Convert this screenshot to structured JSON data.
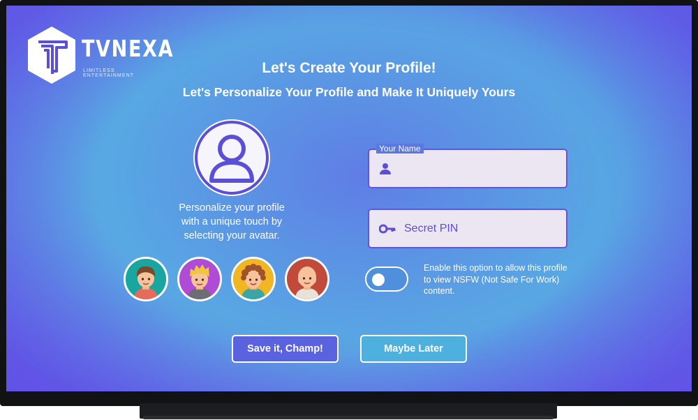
{
  "brand": {
    "name": "TVNEXA",
    "tagline": "LIMITLESS ENTERTAINMENT"
  },
  "header": {
    "title": "Let's Create Your Profile!",
    "subtitle": "Let's Personalize Your Profile and Make It Uniquely Yours"
  },
  "avatar": {
    "caption_line1": "Personalize your profile",
    "caption_line2": "with a unique touch by",
    "caption_line3": "selecting your avatar.",
    "choices": [
      {
        "name": "avatar-boy-brown-hair",
        "bg": "#1aa6a0"
      },
      {
        "name": "avatar-blonde-spiky",
        "bg": "#b04bd6"
      },
      {
        "name": "avatar-curly-hair",
        "bg": "#f2b622"
      },
      {
        "name": "avatar-bald-man",
        "bg": "#c24a3b"
      }
    ]
  },
  "form": {
    "name_label": "Your Name",
    "name_value": "",
    "name_icon": "person-icon",
    "pin_placeholder": "Secret PIN",
    "pin_icon": "key-icon",
    "nsfw_text": "Enable this option to allow this profile to view NSFW (Not Safe For Work) content.",
    "nsfw_enabled": false
  },
  "actions": {
    "save_label": "Save it, Champ!",
    "later_label": "Maybe Later"
  },
  "colors": {
    "accent": "#5b4fd6",
    "save_button": "#5b62e0",
    "later_button": "#4db0dd"
  }
}
